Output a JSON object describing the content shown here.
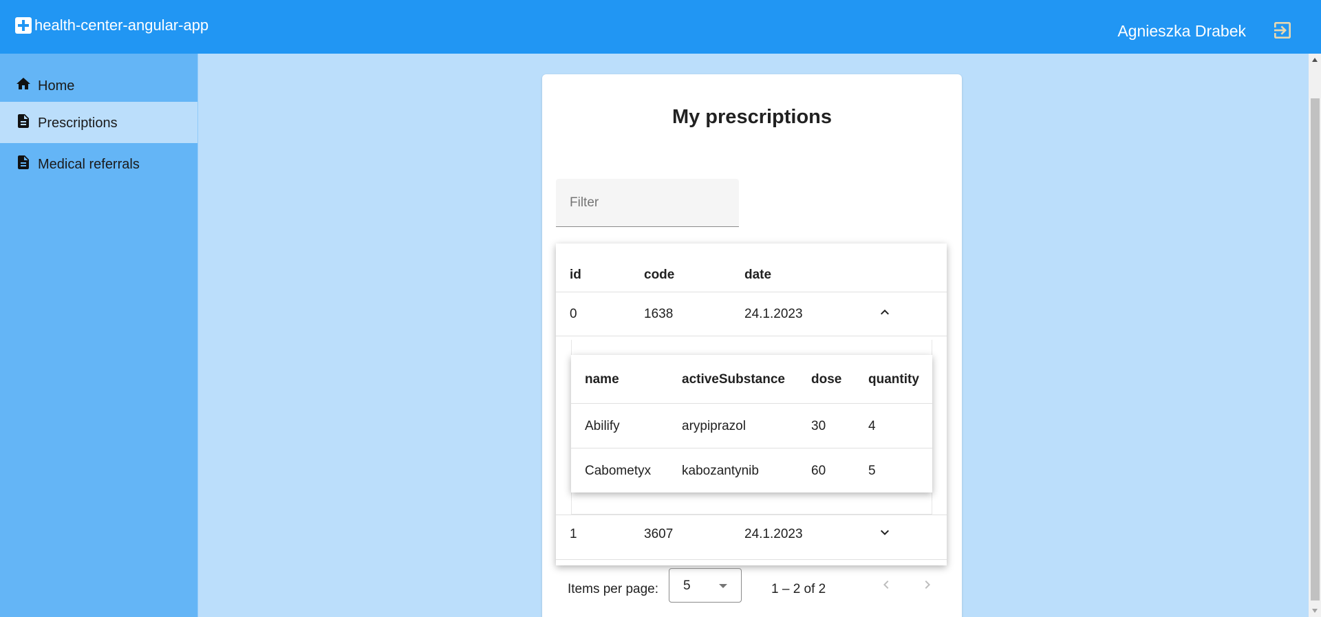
{
  "app": {
    "title": "health-center-angular-app",
    "brand_icon": "plus-square-icon"
  },
  "header": {
    "user_name": "Agnieszka Drabek",
    "logout_icon": "logout-icon"
  },
  "sidebar": {
    "items": [
      {
        "label": "Home",
        "icon": "home-icon",
        "active": false
      },
      {
        "label": "Prescriptions",
        "icon": "document-icon",
        "active": true
      },
      {
        "label": "Medical referrals",
        "icon": "document-icon",
        "active": false
      }
    ]
  },
  "page": {
    "title": "My prescriptions"
  },
  "filter": {
    "placeholder": "Filter",
    "value": ""
  },
  "table": {
    "columns": [
      "id",
      "code",
      "date"
    ],
    "rows": [
      {
        "id": "0",
        "code": "1638",
        "date": "24.1.2023",
        "expanded": true
      },
      {
        "id": "1",
        "code": "3607",
        "date": "24.1.2023",
        "expanded": false
      }
    ]
  },
  "detail_table": {
    "columns": [
      "name",
      "activeSubstance",
      "dose",
      "quantity"
    ],
    "rows": [
      {
        "name": "Abilify",
        "activeSubstance": "arypiprazol",
        "dose": "30",
        "quantity": "4"
      },
      {
        "name": "Cabometyx",
        "activeSubstance": "kabozantynib",
        "dose": "60",
        "quantity": "5"
      }
    ]
  },
  "paginator": {
    "items_per_page_label": "Items per page:",
    "page_size": "5",
    "range_label": "1 – 2 of 2"
  },
  "colors": {
    "toolbar": "#2196f3",
    "sidebar": "#64b5f6",
    "background": "#bbdefb",
    "card": "#ffffff"
  }
}
